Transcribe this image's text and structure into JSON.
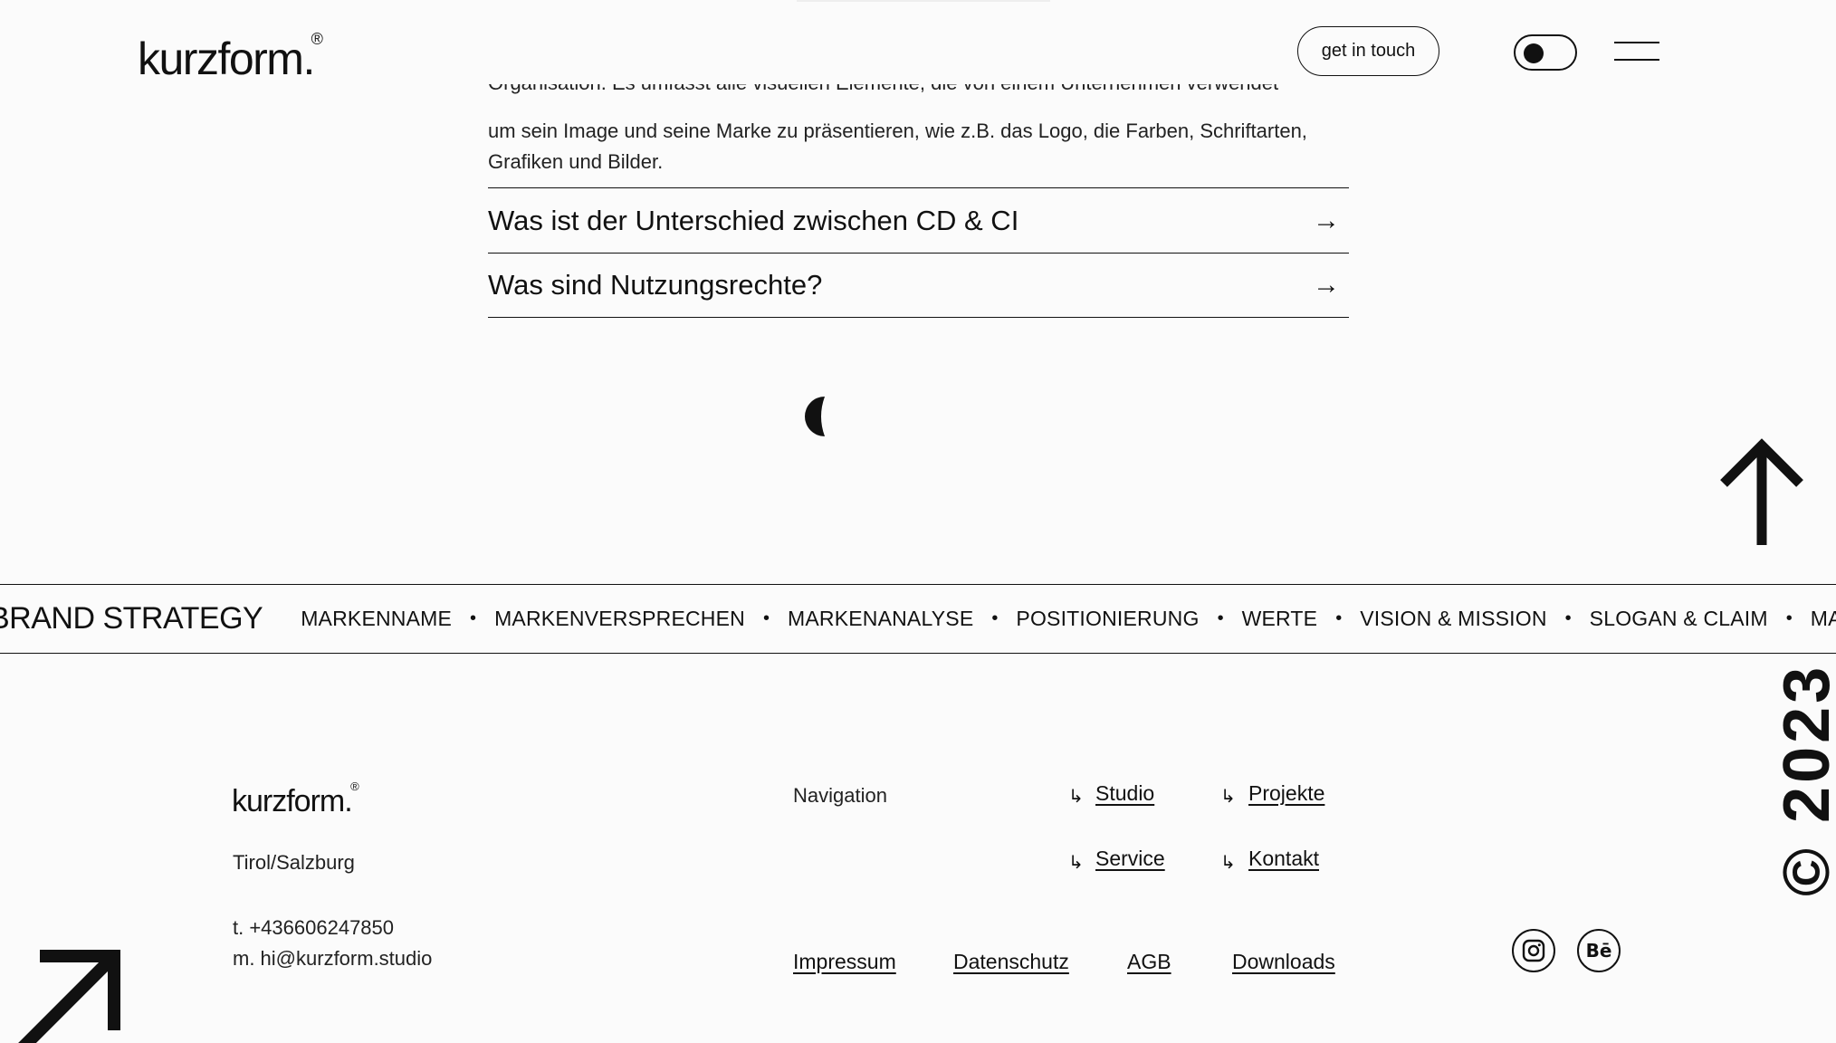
{
  "header": {
    "logo": "kurzform.",
    "logo_mark": "®",
    "cta_label": "get in touch",
    "toggle_icon": "theme-toggle-icon",
    "menu_icon": "hamburger-menu-icon"
  },
  "faq": {
    "partial_line": "Organisation. Es umfasst alle visuellen Elemente, die von einem Unternehmen verwendet werden,",
    "paragraph": "um sein Image und seine Marke zu präsentieren, wie z.B. das Logo, die Farben, Schriftarten, Grafiken und Bilder.",
    "questions": [
      "Was ist der Unterschied zwischen CD & CI",
      "Was sind Nutzungsrechte?"
    ]
  },
  "ticker": {
    "heading": "BRAND STRATEGY",
    "items": [
      "MARKENNAME",
      "MARKENVERSPRECHEN",
      "MARKENANALYSE",
      "POSITIONIERUNG",
      "WERTE",
      "VISION & MISSION",
      "SLOGAN & CLAIM",
      "MARKENWORKSHOP"
    ]
  },
  "footer": {
    "logo": "kurzform.",
    "logo_mark": "®",
    "region": "Tirol/Salzburg",
    "phone": "t. +436606247850",
    "email": "m. hi@kurzform.studio",
    "nav_heading": "Navigation",
    "nav_links": [
      "Studio",
      "Projekte",
      "Service",
      "Kontakt"
    ],
    "legal_links": [
      "Impressum",
      "Datenschutz",
      "AGB",
      "Downloads"
    ],
    "social": [
      "instagram-icon",
      "behance-icon"
    ],
    "behance_label": "Bē",
    "copyright": "© 2023"
  },
  "colors": {
    "text": "#111111",
    "background": "#fbfbfb"
  }
}
